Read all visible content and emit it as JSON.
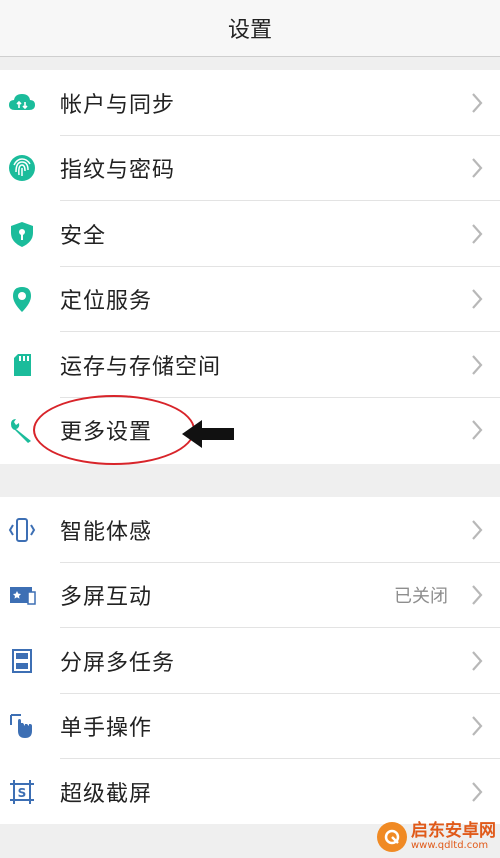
{
  "header": {
    "title": "设置"
  },
  "groups": [
    {
      "items": [
        {
          "label": "帐户与同步",
          "icon": "cloud-sync-icon"
        },
        {
          "label": "指纹与密码",
          "icon": "fingerprint-icon"
        },
        {
          "label": "安全",
          "icon": "shield-icon"
        },
        {
          "label": "定位服务",
          "icon": "location-pin-icon"
        },
        {
          "label": "运存与存储空间",
          "icon": "sd-card-icon"
        },
        {
          "label": "更多设置",
          "icon": "wrench-icon"
        }
      ]
    },
    {
      "items": [
        {
          "label": "智能体感",
          "icon": "phone-motion-icon"
        },
        {
          "label": "多屏互动",
          "icon": "screen-cast-icon",
          "status": "已关闭"
        },
        {
          "label": "分屏多任务",
          "icon": "split-screen-icon"
        },
        {
          "label": "单手操作",
          "icon": "one-hand-icon"
        },
        {
          "label": "超级截屏",
          "icon": "screenshot-icon"
        }
      ]
    }
  ],
  "watermark": {
    "name": "启东安卓网",
    "url": "www.qdltd.com"
  },
  "colors": {
    "green_icon": "#1bbc9b",
    "blue_icon": "#3d6fb4",
    "annotation_red": "#d8242a",
    "chevron": "#b8b8b8",
    "background": "#efefef"
  }
}
